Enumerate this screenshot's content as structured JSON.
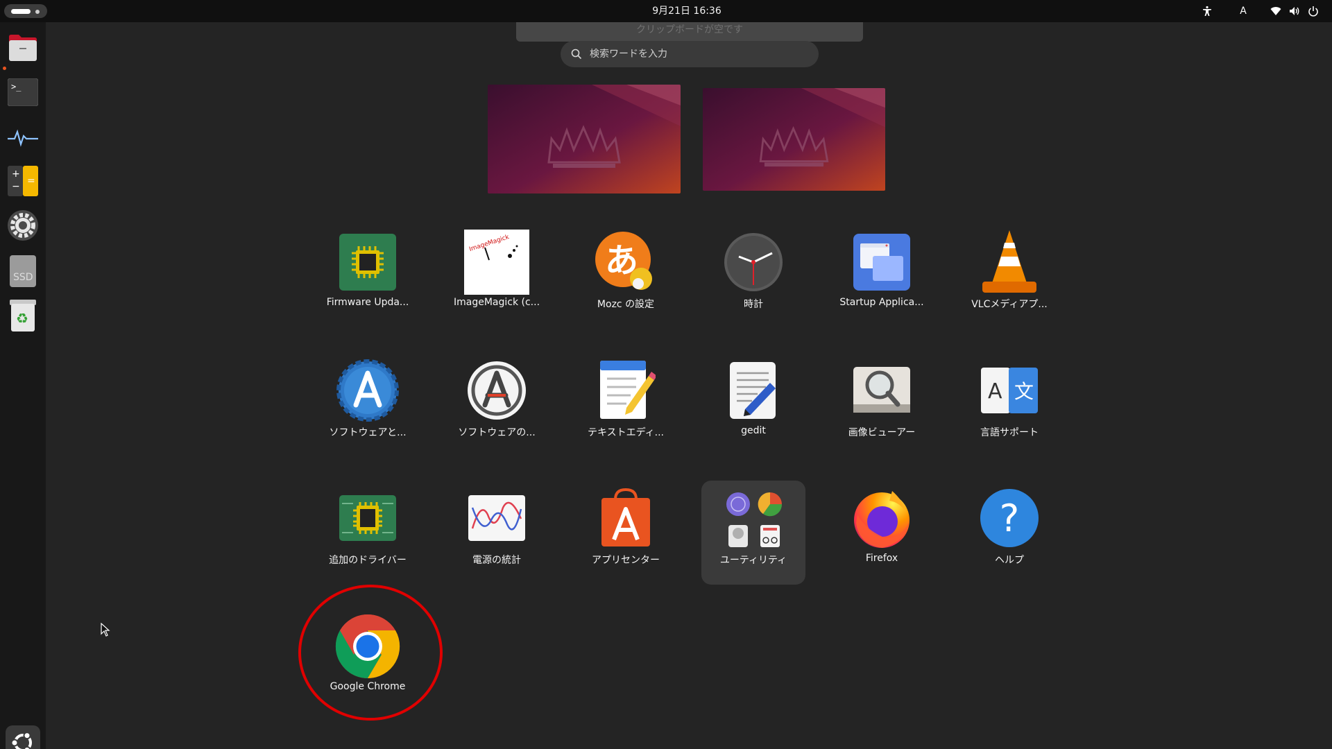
{
  "topbar": {
    "clock": "9月21日  16:36",
    "ime_indicator": "A",
    "icons": [
      "accessibility-icon",
      "wifi-icon",
      "volume-icon",
      "power-icon"
    ]
  },
  "dock": {
    "items": [
      {
        "name": "files",
        "icon": "folder-icon",
        "running": true
      },
      {
        "name": "terminal",
        "icon": "terminal-icon",
        "glyph": ">_"
      },
      {
        "name": "system-monitor",
        "icon": "system-monitor-icon"
      },
      {
        "name": "calculator",
        "icon": "calculator-icon"
      },
      {
        "name": "settings",
        "icon": "gear-icon"
      },
      {
        "name": "ssd",
        "icon": "drive-icon",
        "text": "SSD"
      },
      {
        "name": "trash",
        "icon": "trash-icon"
      }
    ],
    "show_apps_icon": "ubuntu-logo-icon"
  },
  "overview": {
    "notification_text": "クリップボードが空です",
    "search_placeholder": "検索ワードを入力",
    "workspaces": 2
  },
  "apps": [
    {
      "label": "Firmware Upda...",
      "icon": "firmware-chip-icon"
    },
    {
      "label": "ImageMagick (c...",
      "icon": "imagemagick-icon",
      "logo_text": "ImageMagick"
    },
    {
      "label": "Mozc の設定",
      "icon": "mozc-icon",
      "glyph": "あ"
    },
    {
      "label": "時計",
      "icon": "clock-icon"
    },
    {
      "label": "Startup Applica...",
      "icon": "startup-apps-icon"
    },
    {
      "label": "VLCメディアプ...",
      "icon": "vlc-cone-icon"
    },
    {
      "label": "ソフトウェアと...",
      "icon": "software-sources-icon"
    },
    {
      "label": "ソフトウェアの...",
      "icon": "software-updater-icon"
    },
    {
      "label": "テキストエディ...",
      "icon": "text-editor-icon"
    },
    {
      "label": "gedit",
      "icon": "gedit-icon"
    },
    {
      "label": "画像ビューアー",
      "icon": "image-viewer-icon"
    },
    {
      "label": "言語サポート",
      "icon": "language-support-icon",
      "glyphs": [
        "A",
        "文"
      ]
    },
    {
      "label": "追加のドライバー",
      "icon": "drivers-chip-icon"
    },
    {
      "label": "電源の統計",
      "icon": "power-statistics-icon"
    },
    {
      "label": "アプリセンター",
      "icon": "app-center-icon"
    },
    {
      "label": "ユーティリティ",
      "icon": "utilities-folder-icon",
      "folder": true
    },
    {
      "label": "Firefox",
      "icon": "firefox-icon"
    },
    {
      "label": "ヘルプ",
      "icon": "help-icon",
      "glyph": "?"
    },
    {
      "label": "Google Chrome",
      "icon": "chrome-icon",
      "highlighted": true
    }
  ],
  "colors": {
    "background": "#242424",
    "topbar": "#101010",
    "dock": "#181818",
    "highlight": "#e00000",
    "ubuntu_orange": "#e95420"
  }
}
